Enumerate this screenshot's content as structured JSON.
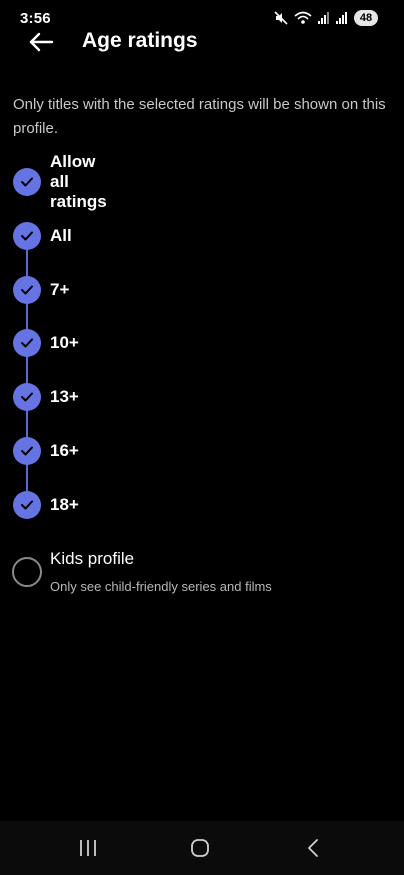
{
  "status_bar": {
    "time": "3:56",
    "battery": "48",
    "icons": [
      "mute-icon",
      "wifi-icon",
      "signal-icon",
      "signal-icon"
    ]
  },
  "header": {
    "title": "Age ratings",
    "back_icon": "arrow-left-icon"
  },
  "description": "Only titles with the selected ratings will be shown on this profile.",
  "ratings": [
    {
      "label": "Allow all ratings",
      "checked": true
    },
    {
      "label": "All",
      "checked": true
    },
    {
      "label": "7+",
      "checked": true
    },
    {
      "label": "10+",
      "checked": true
    },
    {
      "label": "13+",
      "checked": true
    },
    {
      "label": "16+",
      "checked": true
    },
    {
      "label": "18+",
      "checked": true
    }
  ],
  "kids_profile": {
    "title": "Kids profile",
    "subtitle": "Only see child-friendly series and films",
    "selected": false
  },
  "nav": {
    "icons": [
      "recents-icon",
      "home-icon",
      "back-icon"
    ]
  },
  "colors": {
    "accent": "#6573e3",
    "background": "#000000"
  }
}
